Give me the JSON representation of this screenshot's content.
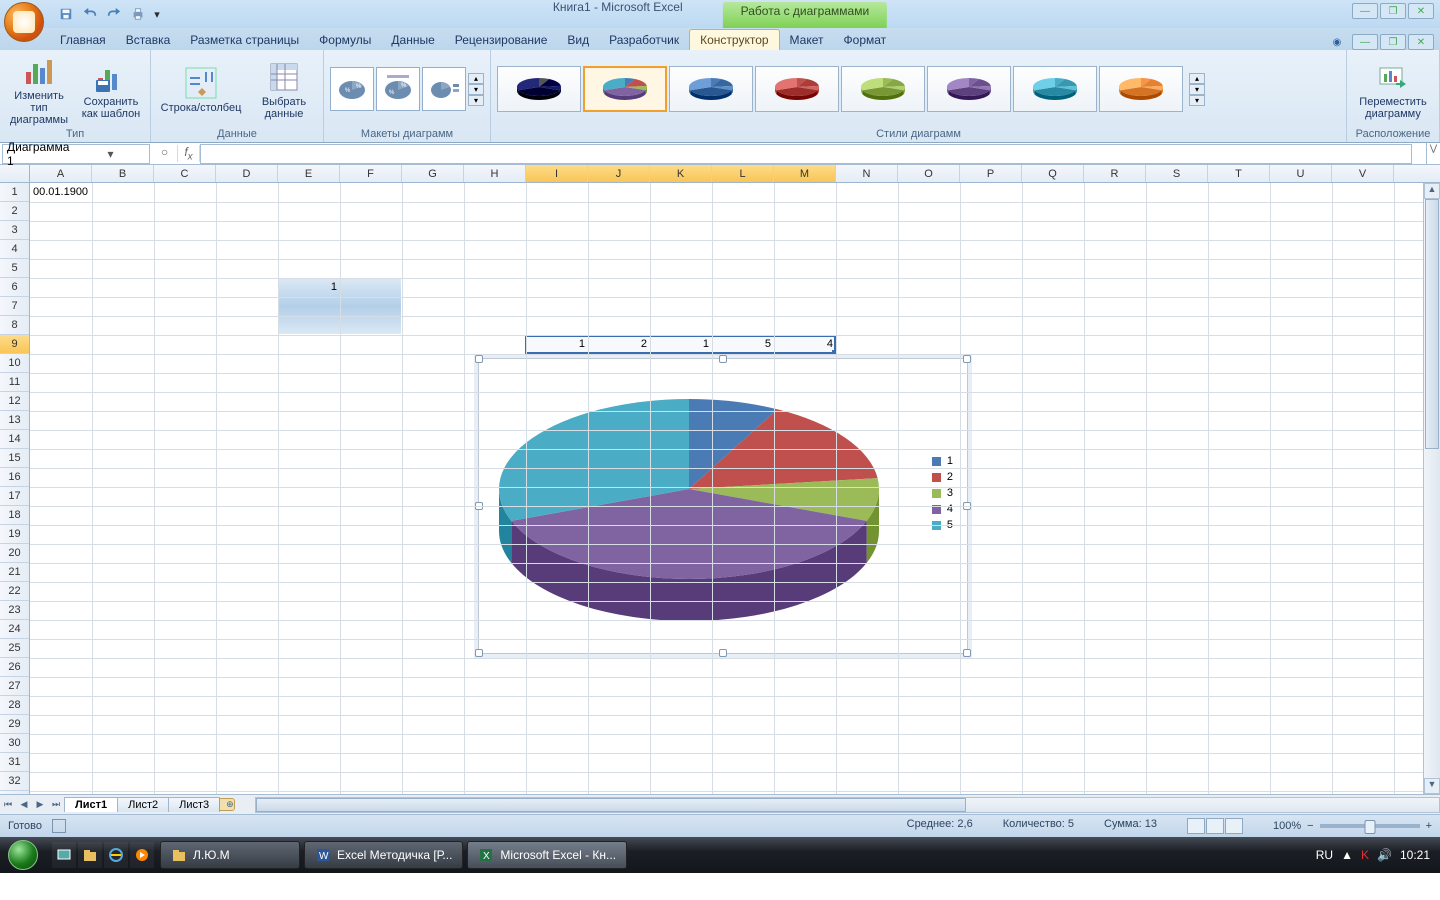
{
  "title": {
    "doc": "Книга1 - Microsoft Excel",
    "context": "Работа с диаграммами"
  },
  "tabs": {
    "items": [
      "Главная",
      "Вставка",
      "Разметка страницы",
      "Формулы",
      "Данные",
      "Рецензирование",
      "Вид",
      "Разработчик",
      "Конструктор",
      "Макет",
      "Формат"
    ],
    "active": "Конструктор"
  },
  "ribbon": {
    "type": {
      "change": "Изменить тип\nдиаграммы",
      "save": "Сохранить\nкак шаблон",
      "label": "Тип"
    },
    "data": {
      "swap": "Строка/столбец",
      "select": "Выбрать\nданные",
      "label": "Данные"
    },
    "layouts": {
      "label": "Макеты диаграмм"
    },
    "styles": {
      "label": "Стили диаграмм"
    },
    "location": {
      "move": "Переместить\nдиаграмму",
      "label": "Расположение"
    }
  },
  "namebox": "Диаграмма 1",
  "columns": [
    "A",
    "B",
    "C",
    "D",
    "E",
    "F",
    "G",
    "H",
    "I",
    "J",
    "K",
    "L",
    "M",
    "N",
    "O",
    "P",
    "Q",
    "R",
    "S",
    "T",
    "U",
    "V"
  ],
  "rowcount": 32,
  "cells": {
    "A1": "00.01.1900",
    "E6": "1",
    "row9": {
      "I": "1",
      "J": "2",
      "K": "1",
      "L": "5",
      "M": "4"
    }
  },
  "chart_data": {
    "type": "pie",
    "categories": [
      "1",
      "2",
      "3",
      "4",
      "5"
    ],
    "values": [
      1,
      2,
      1,
      5,
      4
    ],
    "colors": [
      "#4a7bb5",
      "#c0504d",
      "#9bbb59",
      "#8064a2",
      "#4bacc6"
    ],
    "title": "",
    "legend_position": "right"
  },
  "sheets": {
    "items": [
      "Лист1",
      "Лист2",
      "Лист3"
    ],
    "active": "Лист1"
  },
  "status": {
    "ready": "Готово",
    "avg_label": "Среднее:",
    "avg": "2,6",
    "count_label": "Количество:",
    "count": "5",
    "sum_label": "Сумма:",
    "sum": "13",
    "zoom": "100%",
    "lang": "RU"
  },
  "taskbar": {
    "items": [
      "Л.Ю.М",
      "Excel Методичка [Р...",
      "Microsoft Excel - Кн..."
    ],
    "clock": "10:21"
  }
}
